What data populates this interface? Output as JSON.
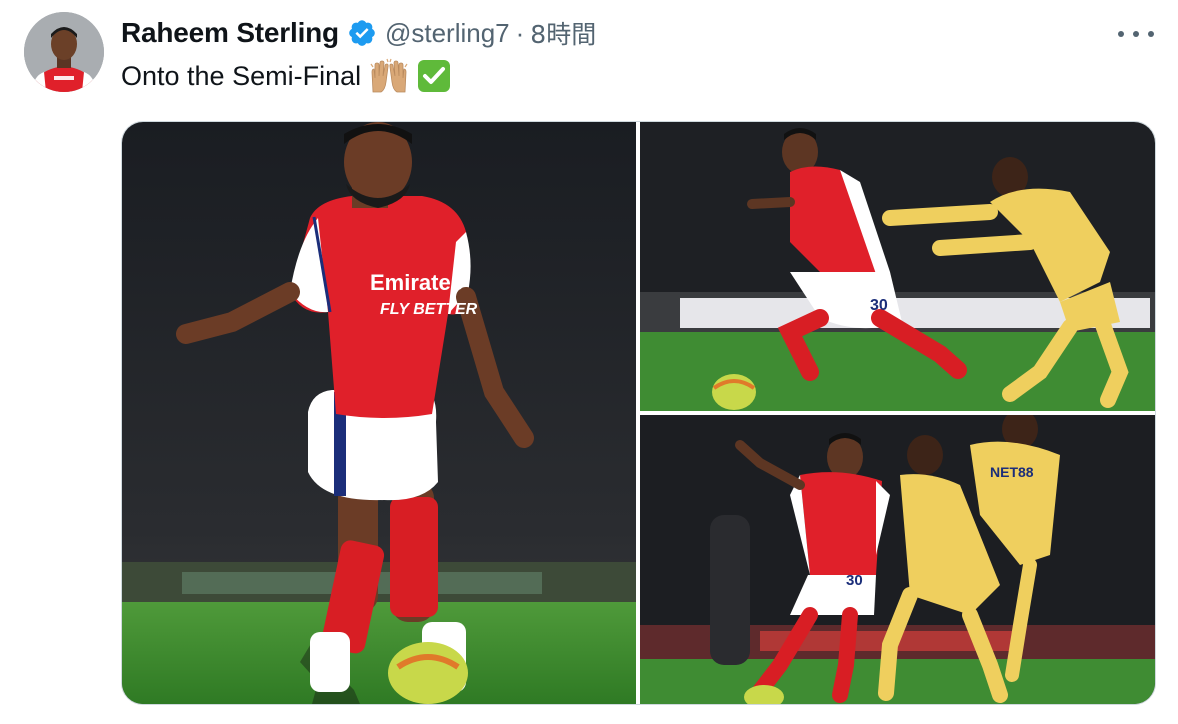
{
  "tweet": {
    "author_name": "Raheem Sterling",
    "handle": "@sterling7",
    "separator": "·",
    "time": "8時間",
    "text": "Onto the Semi-Final",
    "emojis": [
      "raising-hands-emoji",
      "check-mark-button-emoji"
    ]
  },
  "colors": {
    "verified_blue": "#1d9bf0",
    "text_primary": "#0f1419",
    "text_secondary": "#536471",
    "arsenal_red": "#e0202a",
    "palace_yellow": "#efcf5e"
  },
  "icons": {
    "verified": "verified-badge-icon",
    "more": "more-horizontal-icon"
  },
  "photos": [
    {
      "alt": "Sterling dribbling the ball in Arsenal home kit",
      "shirt_number": ""
    },
    {
      "alt": "Sterling shielding the ball from a Crystal Palace defender",
      "shirt_number": "30"
    },
    {
      "alt": "Sterling holding off two Crystal Palace players",
      "shirt_number": "30"
    }
  ],
  "kit_text": {
    "sponsor_line1": "Emirates",
    "sponsor_line2": "FLY BETTER",
    "opponent_sponsor": "NET88"
  }
}
